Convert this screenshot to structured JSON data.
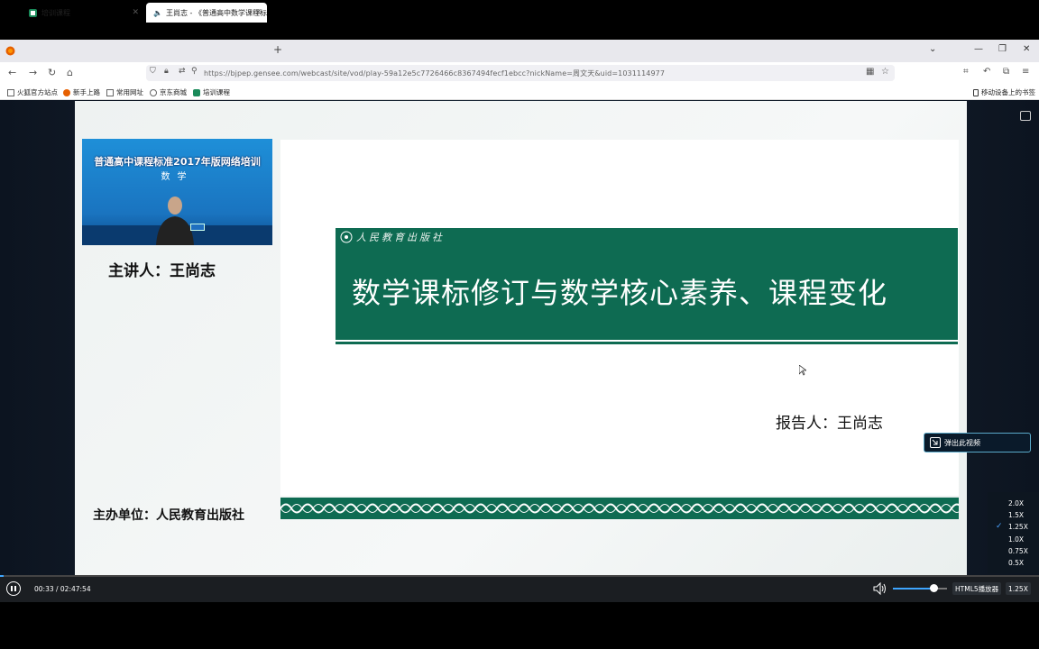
{
  "browser": {
    "tabs": [
      {
        "label": "培训课程",
        "active": false
      },
      {
        "label": "王尚志 - 《普通高中数学课程标",
        "active": true
      }
    ],
    "url": "https://bjpep.gensee.com/webcast/site/vod/play-59a12e5c7726466c8367494fecf1ebcc?nickName=周文天&uid=1031114977",
    "bookmarks": [
      "火狐官方站点",
      "新手上路",
      "常用网址",
      "京东商城",
      "培训课程"
    ],
    "mobile_bookmarks": "移动设备上的书签"
  },
  "slide": {
    "video_line1": "普通高中课程标准2017年版网络培训",
    "video_line2": "数学",
    "lecturer": "主讲人：王尚志",
    "logo_text": "人民教育出版社",
    "title": "数学课标修订与数学核心素养、课程变化",
    "reporter": "报告人：王尚志",
    "organizer": "主办单位：人民教育出版社"
  },
  "player": {
    "popout_label": "弹出此视频",
    "speeds": [
      "2.0X",
      "1.5X",
      "1.25X",
      "1.0X",
      "0.75X",
      "0.5X"
    ],
    "selected_speed": "1.25X",
    "time": "00:33 / 02:47:54",
    "progress_fraction": 0.0033,
    "volume_fraction": 0.75,
    "html5_label": "HTML5播放器",
    "rate_label": "1.25X"
  },
  "colors": {
    "slide_green": "#0e6b52",
    "accent_blue": "#3ea6ff"
  }
}
